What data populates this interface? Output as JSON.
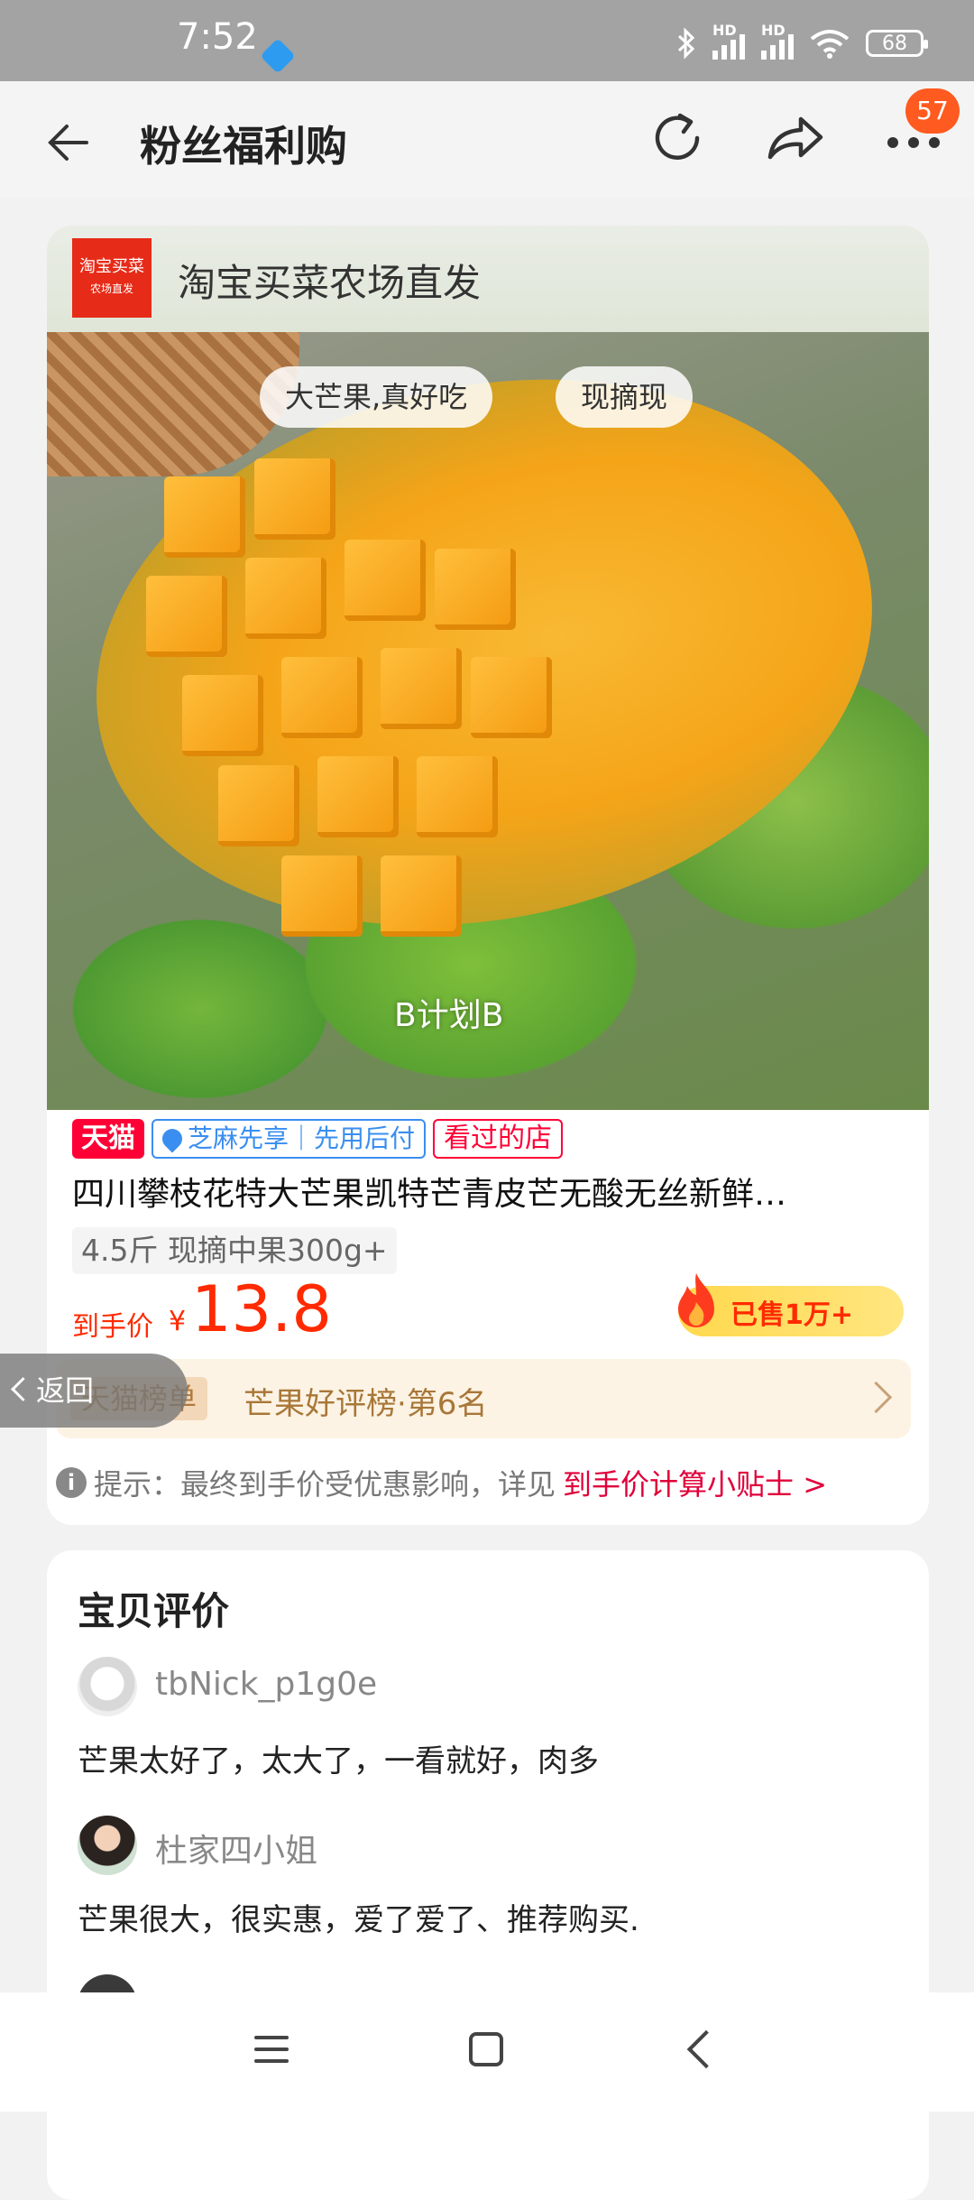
{
  "status_bar": {
    "time": "7:52",
    "battery": "68",
    "signal_label": "HD"
  },
  "header": {
    "title": "粉丝福利购",
    "badge_count": "57"
  },
  "store": {
    "name": "淘宝买菜农场直发",
    "logo_line1": "淘宝买菜",
    "logo_line2": "农场直发"
  },
  "hero": {
    "tags": [
      "大芒果,真好吃",
      "现摘现"
    ],
    "caption": "B计划B"
  },
  "badges": {
    "tmall": "天猫",
    "zhima": "芝麻先享｜先用后付",
    "visited": "看过的店"
  },
  "product": {
    "title": "四川攀枝花特大芒果凯特芒青皮芒无酸无丝新鲜…",
    "spec": "4.5斤 现摘中果300g+",
    "price_label": "到手价",
    "price_currency": "¥",
    "price": "13.8",
    "sold": "已售1万+"
  },
  "ranking": {
    "chip": "天猫榜单",
    "text": "芒果好评榜·第6名"
  },
  "tip": {
    "icon": "i",
    "text": "提示：最终到手价受优惠影响，详见",
    "link": "到手价计算小贴士 >"
  },
  "return_button": "返回",
  "reviews": {
    "title": "宝贝评价",
    "items": [
      {
        "name": "tbNick_p1g0e",
        "text": "芒果太好了，太大了，一看就好，肉多"
      },
      {
        "name": "杜家四小姐",
        "text": "芒果很大，很实惠，爱了爱了、推荐购买."
      }
    ]
  },
  "colors": {
    "accent": "#ff2a00",
    "tmall": "#ff0036",
    "badge": "#ff5a1f"
  },
  "icons": {
    "back": "arrow-left-icon",
    "refresh": "refresh-icon",
    "share": "share-icon",
    "more": "more-dots-icon"
  }
}
